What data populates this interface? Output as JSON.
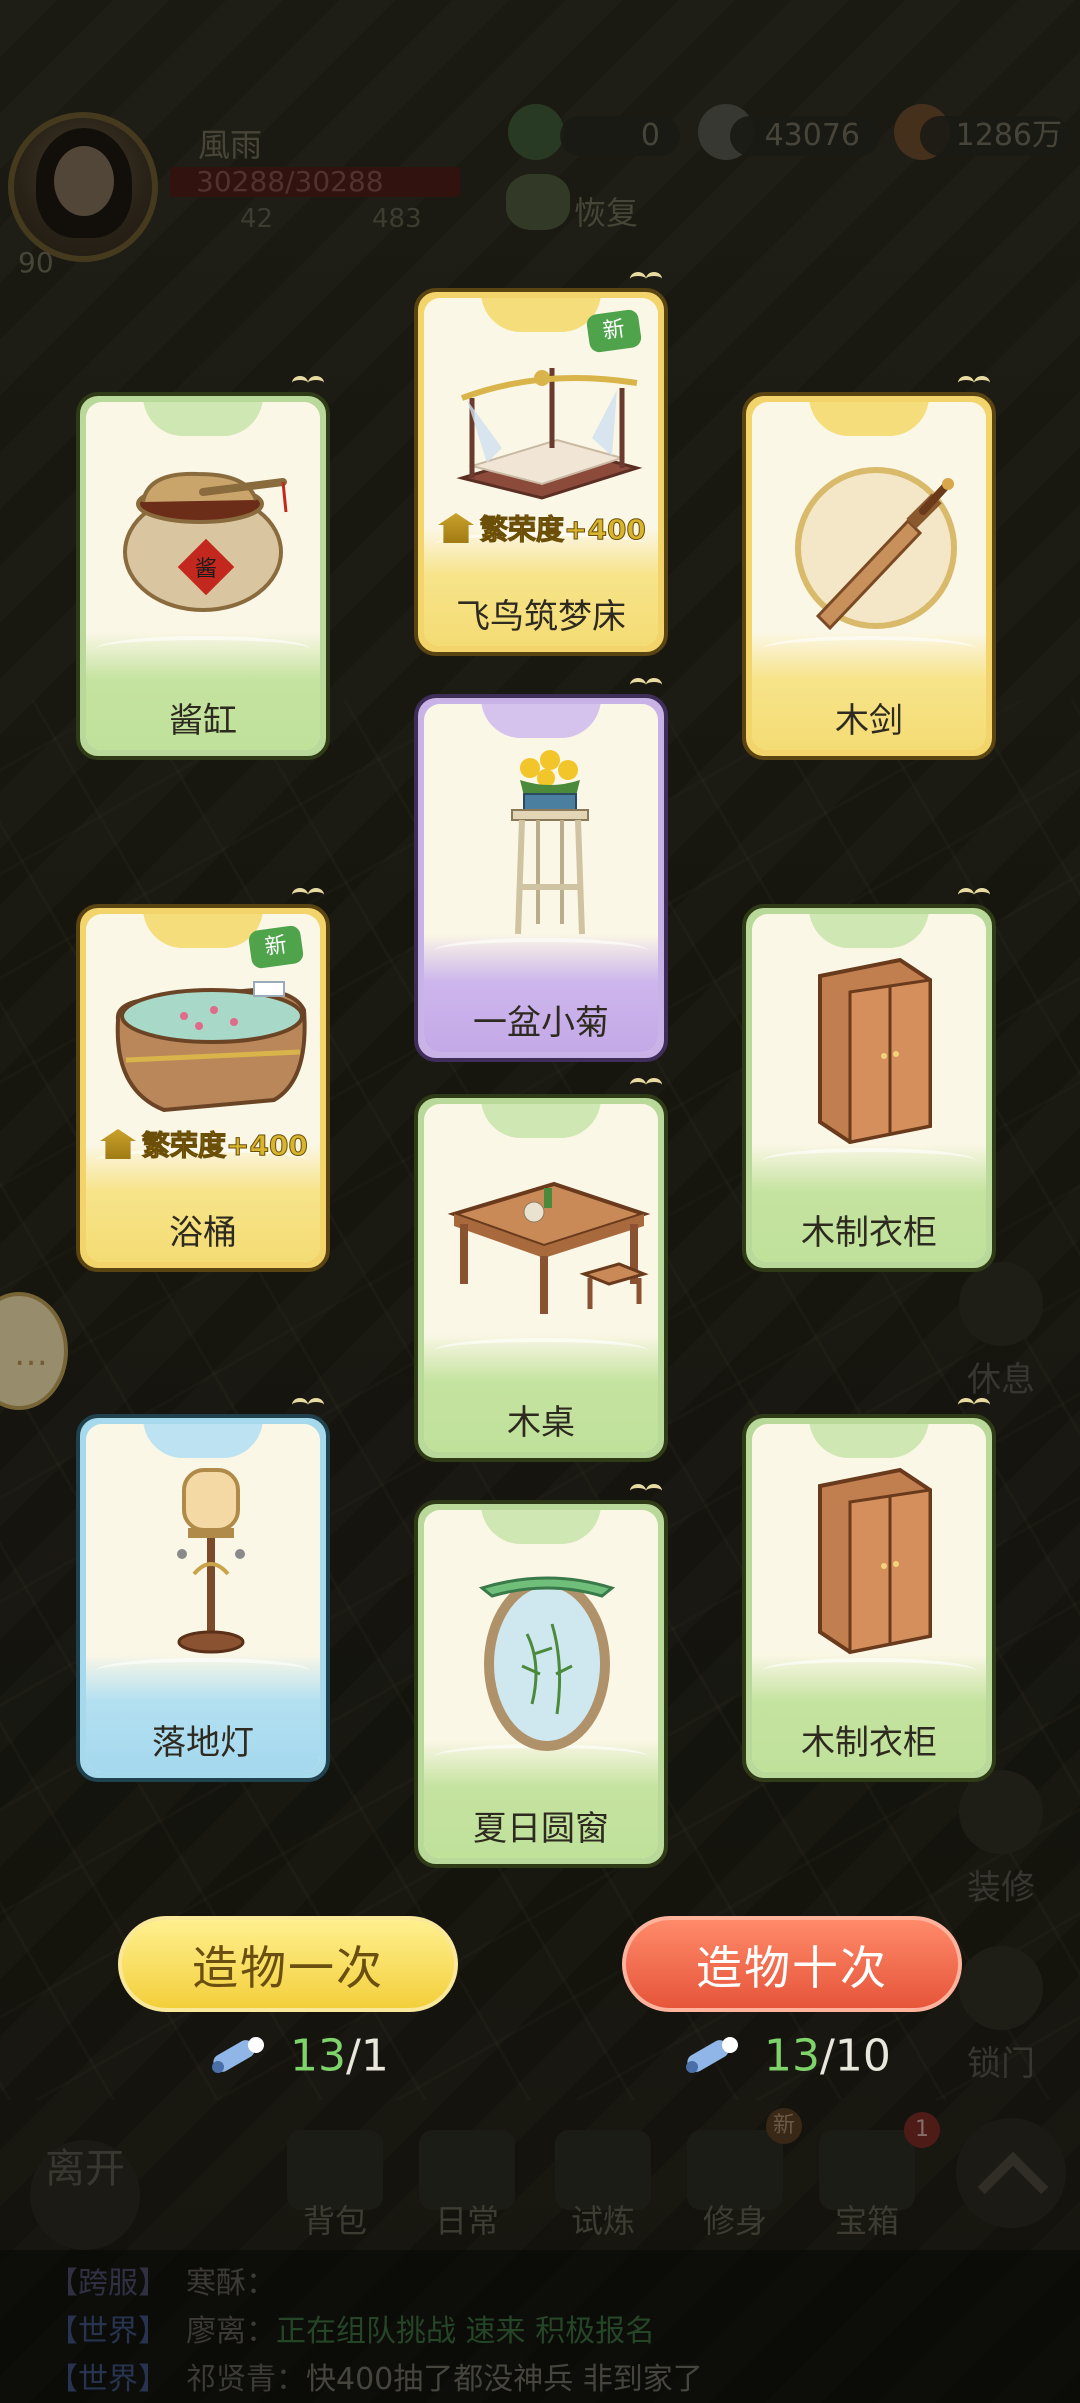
{
  "player": {
    "name": "風雨",
    "hp": "30288/30288",
    "level": "90",
    "stat_a": "42",
    "stat_b": "483"
  },
  "resources": {
    "res1": "0",
    "res2": "43076",
    "res3": "1286万",
    "recover_label": "恢复"
  },
  "cards": [
    {
      "label": "酱缸"
    },
    {
      "label": "飞鸟筑梦床",
      "new_badge": "新",
      "prosperity": "繁荣度+400"
    },
    {
      "label": "木剑"
    },
    {
      "label": "一盆小菊"
    },
    {
      "label": "浴桶",
      "new_badge": "新",
      "prosperity": "繁荣度+400"
    },
    {
      "label": "木制衣柜"
    },
    {
      "label": "木桌"
    },
    {
      "label": "落地灯"
    },
    {
      "label": "木制衣柜"
    },
    {
      "label": "夏日圆窗"
    }
  ],
  "actions": {
    "once_label": "造物一次",
    "ten_label": "造物十次",
    "once_have": "13",
    "once_need": "/1",
    "ten_have": "13",
    "ten_need": "/10"
  },
  "side_buttons": {
    "rest": "休息",
    "decorate": "装修",
    "lock": "锁门"
  },
  "bottom_nav": {
    "leave": "离开",
    "bag": "背包",
    "daily": "日常",
    "trial": "试炼",
    "cultivate": "修身",
    "chest": "宝箱",
    "chest_badge": "1",
    "cultivate_badge": "新"
  },
  "chat": [
    {
      "channel": "【跨服】",
      "who": "寒酥：",
      "msg": ""
    },
    {
      "channel": "【世界】",
      "who": "廖离：",
      "msg": "正在组队挑战 速来 积极报名"
    },
    {
      "channel": "【世界】",
      "who": "祁贤青：",
      "msg": "快400抽了都没神兵  非到家了"
    }
  ]
}
